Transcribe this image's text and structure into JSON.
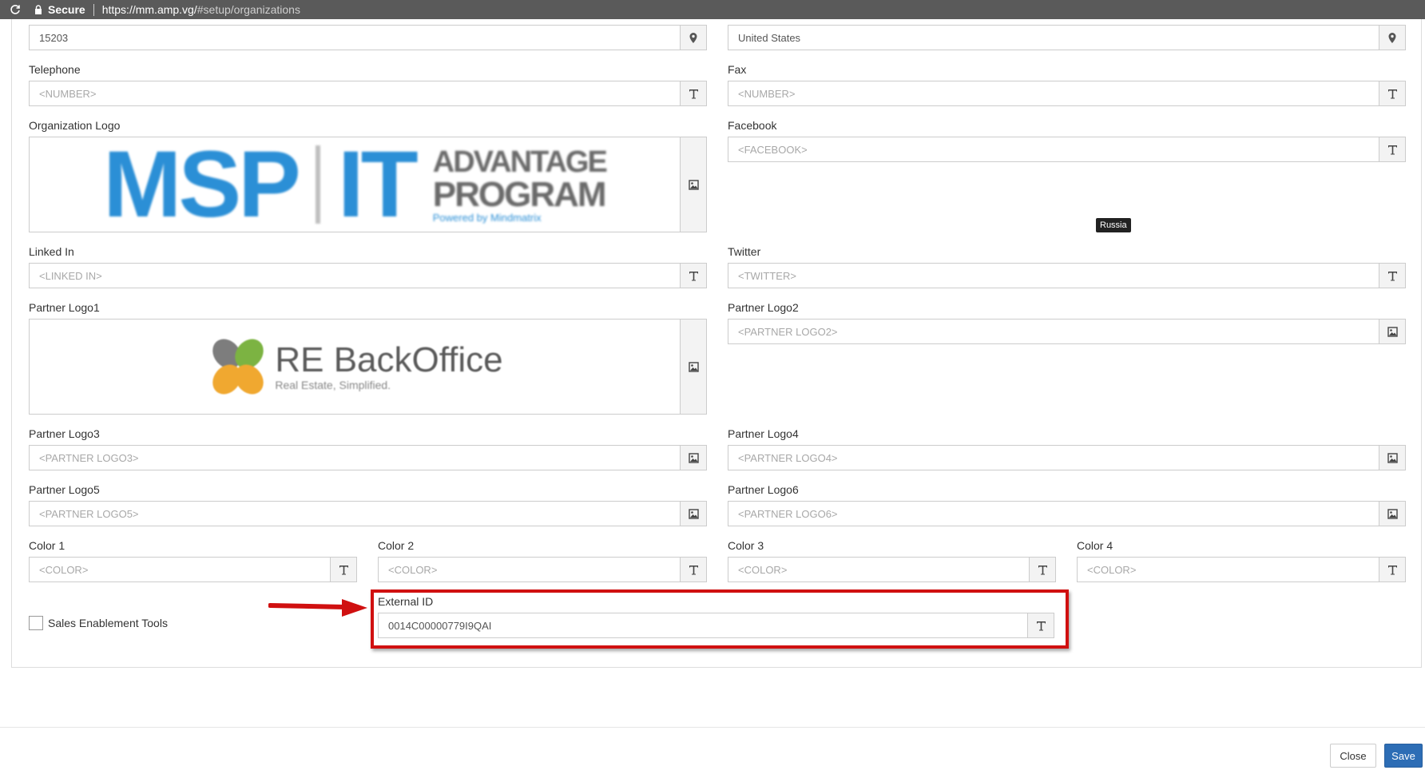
{
  "browser": {
    "secure_label": "Secure",
    "url_host": "https://mm.amp.vg/",
    "url_path": "#setup/organizations"
  },
  "form": {
    "zip_value": "15203",
    "country_value": "United States",
    "telephone": {
      "label": "Telephone",
      "placeholder": "<NUMBER>"
    },
    "fax": {
      "label": "Fax",
      "placeholder": "<NUMBER>"
    },
    "organization_logo": {
      "label": "Organization Logo",
      "logo_text_1": "MSP",
      "logo_text_2": "IT",
      "logo_text_3": "ADVANTAGE",
      "logo_text_4": "PROGRAM",
      "logo_text_5": "Powered by Mindmatrix"
    },
    "facebook": {
      "label": "Facebook",
      "placeholder": "<FACEBOOK>"
    },
    "linkedin": {
      "label": "Linked In",
      "placeholder": "<LINKED IN>"
    },
    "twitter": {
      "label": "Twitter",
      "placeholder": "<TWITTER>"
    },
    "partner_logo1": {
      "label": "Partner Logo1",
      "logo_text_1": "RE BackOffice",
      "logo_text_2": "Real Estate, Simplified."
    },
    "partner_logo2": {
      "label": "Partner Logo2",
      "placeholder": "<PARTNER LOGO2>"
    },
    "partner_logo3": {
      "label": "Partner Logo3",
      "placeholder": "<PARTNER LOGO3>"
    },
    "partner_logo4": {
      "label": "Partner Logo4",
      "placeholder": "<PARTNER LOGO4>"
    },
    "partner_logo5": {
      "label": "Partner Logo5",
      "placeholder": "<PARTNER LOGO5>"
    },
    "partner_logo6": {
      "label": "Partner Logo6",
      "placeholder": "<PARTNER LOGO6>"
    },
    "color1": {
      "label": "Color 1",
      "placeholder": "<COLOR>"
    },
    "color2": {
      "label": "Color 2",
      "placeholder": "<COLOR>"
    },
    "color3": {
      "label": "Color 3",
      "placeholder": "<COLOR>"
    },
    "color4": {
      "label": "Color 4",
      "placeholder": "<COLOR>"
    },
    "sales_enablement_label": "Sales Enablement Tools",
    "external_id": {
      "label": "External ID",
      "value": "0014C00000779I9QAI"
    }
  },
  "tooltip": "Russia",
  "footer": {
    "close_label": "Close",
    "save_label": "Save"
  },
  "colors": {
    "highlight": "#d01010",
    "save_button": "#2d6db5",
    "logo_blue": "#2b8fd6"
  },
  "icons": {
    "zip": "map-marker-icon",
    "country": "map-marker-icon",
    "text": "text-format-icon",
    "image": "image-icon"
  }
}
